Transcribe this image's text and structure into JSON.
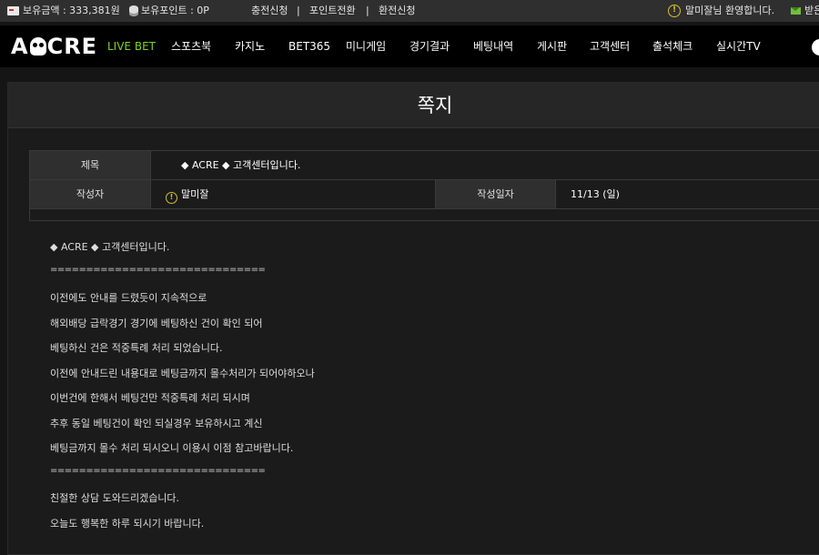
{
  "topbar": {
    "balance_label": "보유금액 : 333,381원",
    "points_label": "보유포인트 : 0P",
    "links": [
      "충전신청",
      "포인트전환",
      "환전신청"
    ],
    "separator": "|",
    "welcome": "말미잘님 환영합니다.",
    "inbox_label": "받은"
  },
  "nav": {
    "logo": "ACRE",
    "items": [
      "LIVE BET",
      "스포츠북",
      "카지노",
      "BET365",
      "미니게임",
      "경기결과",
      "베팅내역",
      "게시판",
      "고객센터",
      "출석체크",
      "실시간TV"
    ],
    "active_color": "#7ed321"
  },
  "page": {
    "title": "쪽지"
  },
  "message": {
    "subject_label": "제목",
    "subject": "◆ ACRE ◆ 고객센터입니다.",
    "author_label": "작성자",
    "author": "말미잘",
    "date_label": "작성일자",
    "date": "11/13 (일)",
    "body": [
      "◆ ACRE ◆ 고객센터입니다.",
      "==============================",
      "이전에도 안내를 드렸듯이 지속적으로",
      "해외배당 급락경기 경기에 베팅하신 건이 확인 되어",
      "베팅하신 건은 적중특례 처리 되었습니다.",
      "이전에 안내드린 내용대로 베팅금까지 몰수처리가 되어야하오나",
      "이번건에 한해서 베팅건만 적중특례 처리 되시며",
      "추후 동일 베팅건이 확인 되실경우 보유하시고 계신",
      "베팅금까지 몰수 처리 되시오니 이용시 이점 참고바랍니다.",
      "==============================",
      "친절한 상담 도와드리겠습니다.",
      "오늘도 행복한 하루 되시기 바랍니다."
    ]
  }
}
